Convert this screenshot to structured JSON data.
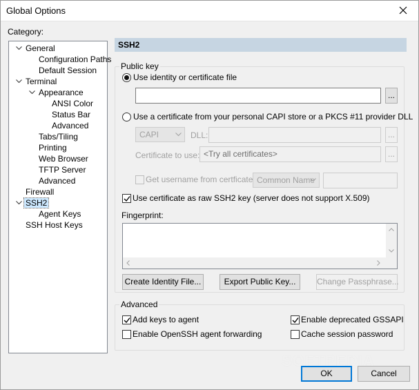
{
  "window": {
    "title": "Global Options"
  },
  "category_label": "Category:",
  "tree": [
    {
      "label": "General",
      "level": 0,
      "expand": "open"
    },
    {
      "label": "Configuration Paths",
      "level": 2,
      "expand": ""
    },
    {
      "label": "Default Session",
      "level": 2,
      "expand": ""
    },
    {
      "label": "Terminal",
      "level": 0,
      "expand": "open"
    },
    {
      "label": "Appearance",
      "level": 1,
      "expand": "open"
    },
    {
      "label": "ANSI Color",
      "level": 3,
      "expand": ""
    },
    {
      "label": "Status Bar",
      "level": 3,
      "expand": ""
    },
    {
      "label": "Advanced",
      "level": 3,
      "expand": ""
    },
    {
      "label": "Tabs/Tiling",
      "level": 2,
      "expand": ""
    },
    {
      "label": "Printing",
      "level": 2,
      "expand": ""
    },
    {
      "label": "Web Browser",
      "level": 2,
      "expand": ""
    },
    {
      "label": "TFTP Server",
      "level": 2,
      "expand": ""
    },
    {
      "label": "Advanced",
      "level": 2,
      "expand": ""
    },
    {
      "label": "Firewall",
      "level": 0,
      "expand": ""
    },
    {
      "label": "SSH2",
      "level": 0,
      "expand": "open",
      "selected": true
    },
    {
      "label": "Agent Keys",
      "level": 2,
      "expand": ""
    },
    {
      "label": "SSH Host Keys",
      "level": 0,
      "expand": ""
    }
  ],
  "header": "SSH2",
  "public_key": {
    "group_title": "Public key",
    "use_identity_label": "Use identity or certificate file",
    "identity_path": "",
    "browse": "...",
    "use_capi_label": "Use a certificate from your personal CAPI store or a PKCS #11 provider DLL",
    "store_value": "CAPI",
    "dll_label": "DLL:",
    "dll_value": "",
    "cert_label": "Certificate to use:",
    "cert_value": "<Try all certificates>",
    "get_username_label": "Get username from certficate:",
    "username_source": "Common Name",
    "username_extra": "",
    "raw_key_label": "Use certificate as raw SSH2 key (server does not support X.509)",
    "fingerprint_label": "Fingerprint:",
    "fingerprint_value": "",
    "create_btn": "Create Identity File...",
    "export_btn": "Export Public Key...",
    "change_btn": "Change Passphrase..."
  },
  "advanced": {
    "group_title": "Advanced",
    "add_keys": "Add keys to agent",
    "openssh_forwarding": "Enable OpenSSH agent forwarding",
    "deprecated_gssapi": "Enable deprecated GSSAPI",
    "cache_password": "Cache session password"
  },
  "buttons": {
    "ok": "OK",
    "cancel": "Cancel"
  },
  "watermark": "SOFTPEDIA",
  "colors": {
    "header_bg": "#c6d5e2",
    "selection": "#cce8ff",
    "default_button_border": "#0078d7"
  }
}
